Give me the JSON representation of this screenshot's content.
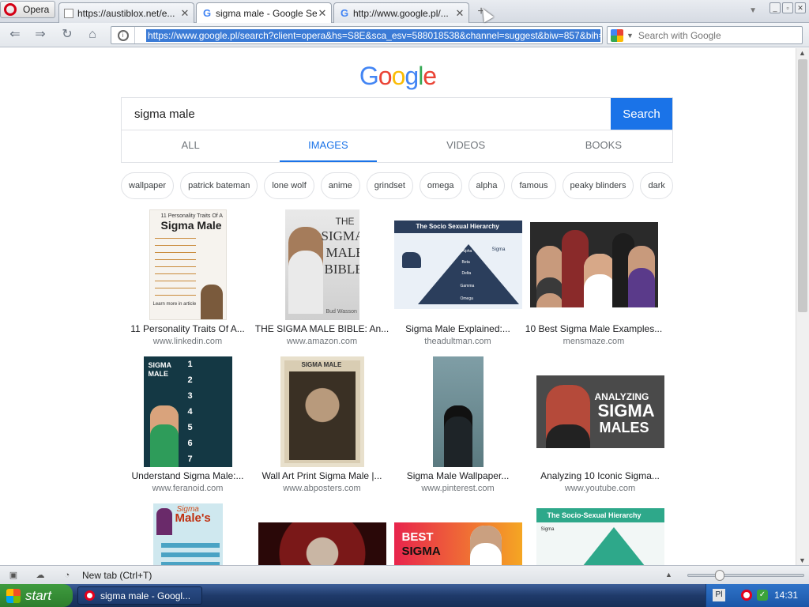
{
  "browser": {
    "menu_label": "Opera",
    "tabs": [
      {
        "title": "https://austiblox.net/e..."
      },
      {
        "title": "sigma male - Google Se..."
      },
      {
        "title": "http://www.google.pl/..."
      }
    ],
    "url": "https://www.google.pl/search?client=opera&hs=S8E&sca_esv=588018538&channel=suggest&biw=857&bih=6",
    "search_placeholder": "Search with Google",
    "status_text": "New tab (Ctrl+T)"
  },
  "google": {
    "logo_letters": [
      "G",
      "o",
      "o",
      "g",
      "l",
      "e"
    ],
    "logo_colors": [
      "#4285f4",
      "#ea4335",
      "#fbbc05",
      "#4285f4",
      "#34a853",
      "#ea4335"
    ],
    "query": "sigma male",
    "search_button": "Search",
    "tabs": [
      "ALL",
      "IMAGES",
      "VIDEOS",
      "BOOKS"
    ],
    "active_tab": "IMAGES",
    "chips": [
      "wallpaper",
      "patrick bateman",
      "lone wolf",
      "anime",
      "grindset",
      "omega",
      "alpha",
      "famous",
      "peaky blinders",
      "dark"
    ],
    "results": [
      {
        "title": "11 Personality Traits Of A...",
        "source": "www.linkedin.com",
        "img_text": [
          "11 Personality Traits Of A",
          "Sigma Male",
          "Learn more in article"
        ]
      },
      {
        "title": "THE SIGMA MALE BIBLE: An...",
        "source": "www.amazon.com",
        "img_text": [
          "THE",
          "SIGMA",
          "MALE",
          "BIBLE",
          "Bud Wasson"
        ]
      },
      {
        "title": "Sigma Male Explained:...",
        "source": "theadultman.com",
        "img_text": [
          "The Socio Sexual Hierarchy",
          "Alpha",
          "Beta",
          "Delta",
          "Gamma",
          "Omega",
          "Sigma"
        ]
      },
      {
        "title": "10 Best Sigma Male Examples...",
        "source": "mensmaze.com",
        "img_text": []
      },
      {
        "title": "Understand Sigma Male:...",
        "source": "www.feranoid.com",
        "img_text": [
          "SIGMA",
          "MALE",
          "1",
          "2",
          "3",
          "4",
          "5",
          "6",
          "7"
        ]
      },
      {
        "title": "Wall Art Print Sigma Male |...",
        "source": "www.abposters.com",
        "img_text": [
          "SIGMA MALE"
        ]
      },
      {
        "title": "Sigma Male Wallpaper...",
        "source": "www.pinterest.com",
        "img_text": []
      },
      {
        "title": "Analyzing 10 Iconic Sigma...",
        "source": "www.youtube.com",
        "img_text": [
          "ANALYZING",
          "SIGMA",
          "MALES"
        ]
      },
      {
        "title": "",
        "source": "",
        "img_text": [
          "Sigma",
          "Male's"
        ]
      },
      {
        "title": "",
        "source": "",
        "img_text": []
      },
      {
        "title": "",
        "source": "",
        "img_text": [
          "BEST",
          "SIGMA"
        ]
      },
      {
        "title": "",
        "source": "",
        "img_text": [
          "The Socio-Sexual Hierarchy",
          "Sigma"
        ]
      }
    ]
  },
  "taskbar": {
    "start_label": "start",
    "item_label": "sigma male - Googl...",
    "lang": "Pl",
    "time": "14:31"
  }
}
